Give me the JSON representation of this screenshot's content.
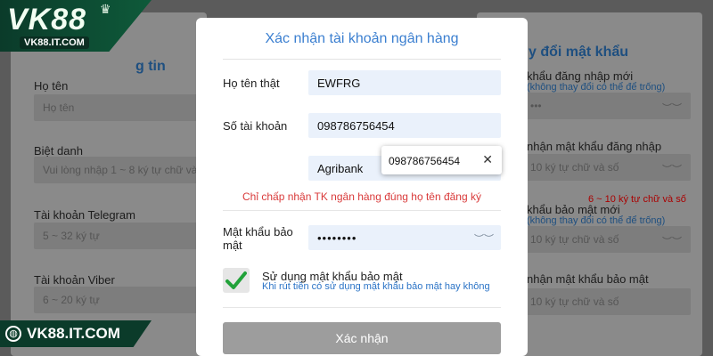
{
  "brand": {
    "logo_text": "VK88",
    "logo_url_text": "VK88.IT.COM",
    "banner_text": "VK88.IT.COM",
    "accent": "#0b3b2a"
  },
  "background_left": {
    "title_fragment": "g tin",
    "fields": [
      {
        "label": "Họ tên",
        "placeholder": "Họ tên"
      },
      {
        "label": "Biệt danh",
        "placeholder": "Vui lòng nhập 1 ~ 8 ký tự chữ và số"
      },
      {
        "label": "Tài khoản Telegram",
        "placeholder": "5 ~ 32 ký tự"
      },
      {
        "label": "Tài khoản Viber",
        "placeholder": "6 ~ 20 ký tự"
      }
    ]
  },
  "background_right": {
    "title_fragment": "y đổi mật khẩu",
    "fields": [
      {
        "label": "khẩu đăng nhập mới",
        "hint": "(không thay đổi có thể để trống)",
        "value": "•••"
      },
      {
        "label": "nhận mật khẩu đăng nhập",
        "placeholder": "10 ký tự chữ và số"
      },
      {
        "label": "khẩu bảo mật mới",
        "hint": "(không thay đổi có thể để trống)",
        "placeholder": "10 ký tự chữ và số"
      },
      {
        "label": "nhận mật khẩu bảo mật",
        "placeholder": "10 ký tự chữ và số"
      }
    ],
    "error": "6 ~ 10 ký tự chữ và số"
  },
  "modal": {
    "title": "Xác nhận tài khoản ngân hàng",
    "full_name_label": "Họ tên thật",
    "full_name_value": "EWFRG",
    "account_label": "Số tài khoản",
    "account_value": "098786756454",
    "bank_value": "Agribank",
    "tooltip_text": "098786756454",
    "tooltip_close": "✕",
    "warning": "Chỉ chấp nhận TK ngân hàng đúng họ tên đăng ký",
    "password_label_line1": "Mật khẩu bảo",
    "password_label_line2": "mật",
    "password_value": "••••••••",
    "checkbox_label": "Sử dụng mật khẩu bảo mật",
    "checkbox_hint": "Khi rút tiền có sử dụng mật khẩu bảo mật hay không",
    "checkbox_checked": true,
    "confirm_button": "Xác nhận",
    "eye_icon": "eye-closed-icon"
  }
}
